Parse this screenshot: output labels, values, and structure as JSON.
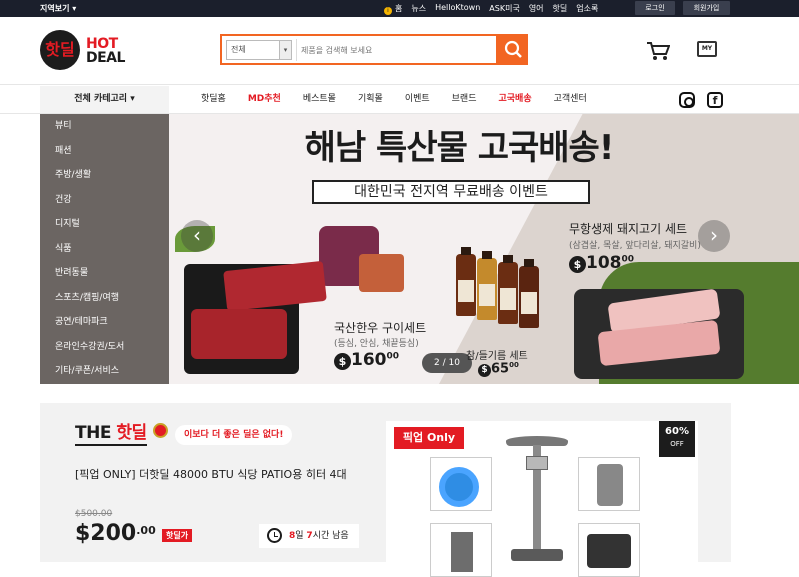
{
  "topbar": {
    "region_label": "지역보기",
    "links": [
      "홈",
      "뉴스",
      "HelloKtown",
      "ASK미국",
      "영어",
      "핫딜",
      "업소록"
    ],
    "login": "로그인",
    "signup": "회원가입"
  },
  "header": {
    "logo_mark": "핫딜",
    "logo_hot": "HOT",
    "logo_deal": "DEAL",
    "search": {
      "category": "전체",
      "placeholder": "제품을 검색해 보세요"
    },
    "my_label": "MY"
  },
  "nav": {
    "all_categories": "전체 카테고리",
    "links": [
      "핫딜홈",
      "MD추천",
      "베스트몰",
      "기획몰",
      "이벤트",
      "브랜드",
      "고국배송",
      "고객센터"
    ],
    "highlighted": [
      "MD추천",
      "고국배송"
    ]
  },
  "sidebar": {
    "items": [
      "뷰티",
      "패션",
      "주방/생활",
      "건강",
      "디지털",
      "식품",
      "반려동물",
      "스포츠/캠핑/여행",
      "공연/테마파크",
      "온라인수강권/도서",
      "기타/쿠폰/서비스"
    ]
  },
  "banner": {
    "title": "해남 특산물 고국배송!",
    "subtitle": "대한민국 전지역 무료배송 이벤트",
    "beef": {
      "name": "국산한우 구이세트",
      "desc": "(등심, 안심, 채끝등심)",
      "price": "160",
      "cents": "00"
    },
    "oil": {
      "name": "참/들기름 세트",
      "price": "65",
      "cents": "00"
    },
    "pork": {
      "name": "무항생제 돼지고기 세트",
      "desc": "(삼겹살, 목살, 앞다리살, 돼지갈비)",
      "price": "108",
      "cents": "00"
    },
    "pager": "2 / 10",
    "dollar_sign": "$"
  },
  "deal": {
    "brand_the": "THE",
    "brand_name": "핫딜",
    "catchphrase": "이보다 더 좋은 딜은 없다!",
    "title": "[픽업 ONLY] 더핫딜 48000 BTU 식당 PATIO용 히터 4대",
    "old_price": "$500.00",
    "price": "$200",
    "price_cents": ".00",
    "tag": "핫딜가",
    "timer": {
      "days": "8",
      "days_unit": "일 ",
      "hours": "7",
      "hours_unit": "시간 남음"
    },
    "image": {
      "pickup_badge": "픽업 Only",
      "discount": "60%",
      "off": "OFF"
    }
  },
  "colors": {
    "brand_red": "#e31b23",
    "search_orange": "#f26522",
    "topbar": "#1b1f2c",
    "sidebar": "#6b6562"
  }
}
